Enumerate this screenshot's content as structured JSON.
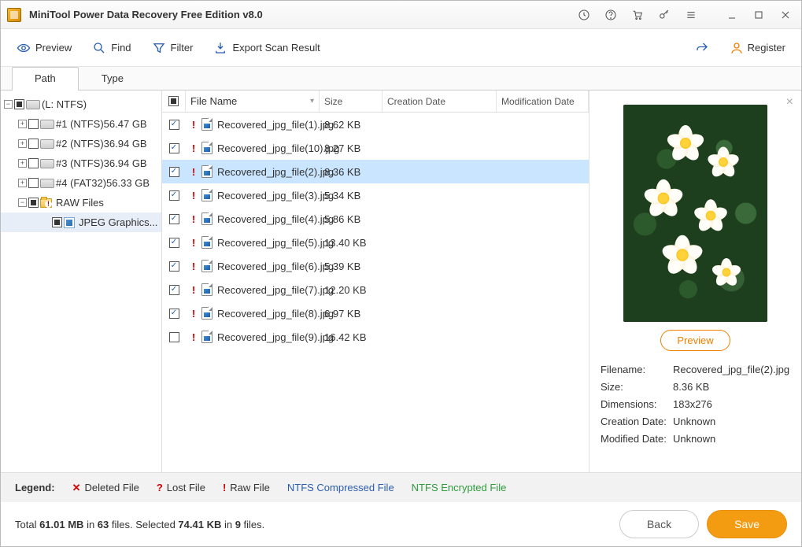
{
  "window": {
    "title": "MiniTool Power Data Recovery Free Edition v8.0"
  },
  "toolbar": {
    "preview": "Preview",
    "find": "Find",
    "filter": "Filter",
    "export": "Export Scan Result",
    "register": "Register"
  },
  "tabs": {
    "path": "Path",
    "type": "Type"
  },
  "tree": {
    "root": "(L: NTFS)",
    "items": [
      {
        "label": "#1 (NTFS)56.47 GB"
      },
      {
        "label": "#2 (NTFS)36.94 GB"
      },
      {
        "label": "#3 (NTFS)36.94 GB"
      },
      {
        "label": "#4 (FAT32)56.33 GB"
      }
    ],
    "raw": "RAW Files",
    "jpeg": "JPEG Graphics..."
  },
  "cols": {
    "name": "File Name",
    "size": "Size",
    "ctime": "Creation Date",
    "mtime": "Modification Date"
  },
  "files": [
    {
      "name": "Recovered_jpg_file(1).jpg",
      "size": "8.62 KB",
      "chk": true
    },
    {
      "name": "Recovered_jpg_file(10).jpg",
      "size": "8.27 KB",
      "chk": true
    },
    {
      "name": "Recovered_jpg_file(2).jpg",
      "size": "8.36 KB",
      "chk": true,
      "sel": true
    },
    {
      "name": "Recovered_jpg_file(3).jpg",
      "size": "5.34 KB",
      "chk": true
    },
    {
      "name": "Recovered_jpg_file(4).jpg",
      "size": "5.86 KB",
      "chk": true
    },
    {
      "name": "Recovered_jpg_file(5).jpg",
      "size": "13.40 KB",
      "chk": true
    },
    {
      "name": "Recovered_jpg_file(6).jpg",
      "size": "5.39 KB",
      "chk": true
    },
    {
      "name": "Recovered_jpg_file(7).jpg",
      "size": "12.20 KB",
      "chk": true
    },
    {
      "name": "Recovered_jpg_file(8).jpg",
      "size": "6.97 KB",
      "chk": true
    },
    {
      "name": "Recovered_jpg_file(9).jpg",
      "size": "16.42 KB",
      "chk": false
    }
  ],
  "preview": {
    "btn": "Preview",
    "k_name": "Filename:",
    "v_name": "Recovered_jpg_file(2).jpg",
    "k_size": "Size:",
    "v_size": "8.36 KB",
    "k_dim": "Dimensions:",
    "v_dim": "183x276",
    "k_ctime": "Creation Date:",
    "v_ctime": "Unknown",
    "k_mtime": "Modified Date:",
    "v_mtime": "Unknown"
  },
  "legend": {
    "label": "Legend:",
    "deleted": "Deleted File",
    "lost": "Lost File",
    "raw": "Raw File",
    "comp": "NTFS Compressed File",
    "enc": "NTFS Encrypted File"
  },
  "footer": {
    "total_pre": "Total ",
    "total_size": "61.01 MB",
    "total_mid": " in ",
    "total_count": "63",
    "total_post": " files.   Selected ",
    "sel_size": "74.41 KB",
    "sel_mid": " in ",
    "sel_count": "9",
    "sel_post": " files.",
    "back": "Back",
    "save": "Save"
  }
}
